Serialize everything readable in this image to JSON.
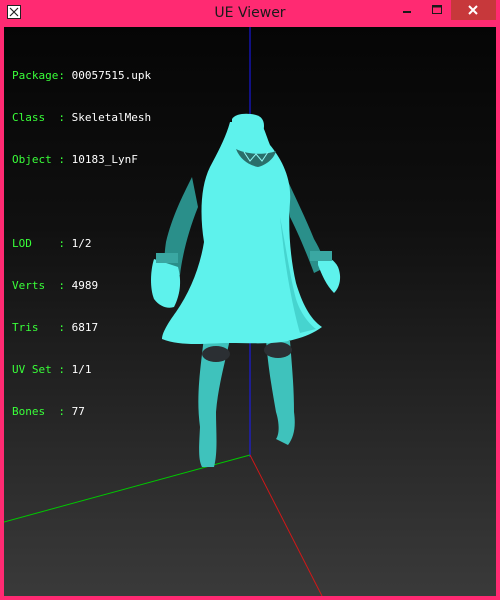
{
  "window": {
    "title": "UE Viewer",
    "frame_color": "#ff2a72",
    "controls": {
      "minimize_icon": "minimize-icon",
      "maximize_icon": "maximize-icon",
      "close_icon": "close-icon",
      "close_bg": "#c7383b"
    }
  },
  "info": {
    "package_key": "Package:",
    "package_value": "00057515.upk",
    "class_key": "Class  :",
    "class_value": "SkeletalMesh",
    "object_key": "Object :",
    "object_value": "10183_LynF",
    "lod_key": "LOD    :",
    "lod_value": "1/2",
    "verts_key": "Verts  :",
    "verts_value": "4989",
    "tris_key": "Tris   :",
    "tris_value": "6817",
    "uvset_key": "UV Set :",
    "uvset_value": "1/1",
    "bones_key": "Bones  :",
    "bones_value": "77"
  },
  "scene": {
    "model": "skeletal-mesh-outfit",
    "mesh_color": "#5ef2ec",
    "axis_colors": {
      "x": "#d01818",
      "y": "#00c800",
      "z": "#1a1aff"
    }
  }
}
